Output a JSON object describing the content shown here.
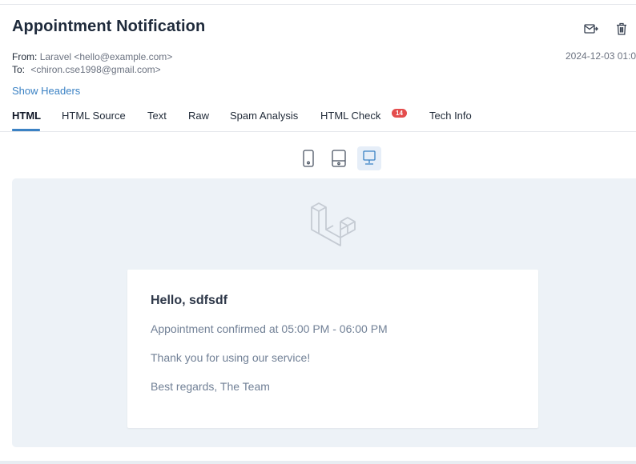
{
  "email": {
    "subject": "Appointment Notification",
    "from_label": "From:",
    "from_value": "Laravel <hello@example.com>",
    "to_label": "To:",
    "to_value": "<chiron.cse1998@gmail.com>",
    "date": "2024-12-03 01:0",
    "show_headers": "Show Headers"
  },
  "actions": {
    "release_icon": "envelope-arrow-icon",
    "delete_icon": "trash-icon"
  },
  "tabs": [
    {
      "label": "HTML",
      "active": true
    },
    {
      "label": "HTML Source"
    },
    {
      "label": "Text"
    },
    {
      "label": "Raw"
    },
    {
      "label": "Spam Analysis"
    },
    {
      "label": "HTML Check",
      "badge": "14"
    },
    {
      "label": "Tech Info"
    }
  ],
  "devices": [
    {
      "icon": "phone-icon"
    },
    {
      "icon": "tablet-icon"
    },
    {
      "icon": "desktop-icon",
      "active": true
    }
  ],
  "message": {
    "greeting": "Hello, sdfsdf",
    "line1": "Appointment confirmed at 05:00 PM - 06:00 PM",
    "line2": "Thank you for using our service!",
    "line3": "Best regards, The Team"
  },
  "colors": {
    "accent": "#3b82c4",
    "badge": "#e44d4d",
    "preview_bg": "#edf2f7"
  }
}
